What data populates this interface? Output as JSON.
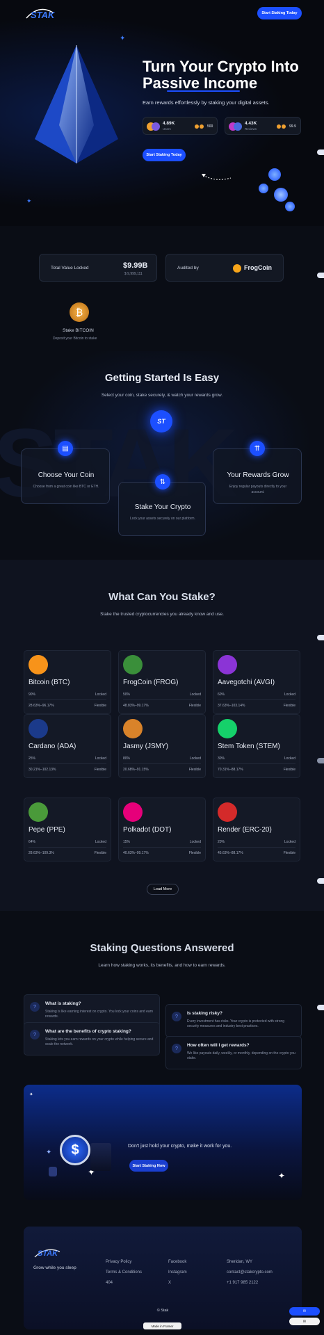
{
  "nav": {
    "logo": "STAK",
    "cta": "Start Staking Today"
  },
  "hero": {
    "title_line1": "Turn Your Crypto Into",
    "title_line2": "Passive Income",
    "subtitle": "Earn rewards effortlessly by staking your digital assets.",
    "stat1_value": "4.89K",
    "stat1_label": "Users",
    "stat1_count": "500",
    "stat2_value": "4.43K",
    "stat2_label": "Reviews",
    "stat2_count": "99.9",
    "cta": "Start Staking Today"
  },
  "tvl": {
    "label": "Total Value Locked",
    "value": "$9.99B",
    "sub": "$ 9,999,111",
    "audited_label": "Audited by",
    "audited_brand": "FrogCoin"
  },
  "stake_coin": {
    "title": "Stake BITCOIN",
    "sub": "Deposit your Bitcoin to stake"
  },
  "getting_started": {
    "title": "Getting Started Is Easy",
    "subtitle": "Select your coin, stake securely, & watch your rewards grow.",
    "step1_title": "Choose Your Coin",
    "step1_desc": "Choose from a great coin like BTC or ETH.",
    "step2_title": "Stake Your Crypto",
    "step2_desc": "Lock your assets securely on our platform.",
    "step3_title": "Your Rewards Grow",
    "step3_desc": "Enjoy regular payouts directly to your account."
  },
  "what_stake": {
    "title": "What Can You Stake?",
    "subtitle": "Stake the trusted cryptocurrencies you already know and use.",
    "coins": [
      {
        "name": "Bitcoin (BTC)",
        "pct": "90%",
        "lock": "Locked",
        "apy": "28.63%–96.17%",
        "flex": "Flexible",
        "color": "#f7931a"
      },
      {
        "name": "FrogCoin (FROG)",
        "pct": "50%",
        "lock": "Locked",
        "apy": "48.83%–99.17%",
        "flex": "Flexible",
        "color": "#3a8f3a"
      },
      {
        "name": "Aavegotchi (AVGI)",
        "pct": "60%",
        "lock": "Locked",
        "apy": "37.63%–103.14%",
        "flex": "Flexible",
        "color": "#8b34d6"
      },
      {
        "name": "Cardano (ADA)",
        "pct": "25%",
        "lock": "Locked",
        "apy": "30.21%–102.13%",
        "flex": "Flexible",
        "color": "#1b3a8a"
      },
      {
        "name": "Jasmy (JSMY)",
        "pct": "80%",
        "lock": "Locked",
        "apy": "20.68%–91.15%",
        "flex": "Flexible",
        "color": "#d9832a"
      },
      {
        "name": "Stem Token (STEM)",
        "pct": "30%",
        "lock": "Locked",
        "apy": "70.31%–88.17%",
        "flex": "Flexible",
        "color": "#15d16a"
      },
      {
        "name": "Pepe (PPE)",
        "pct": "64%",
        "lock": "Locked",
        "apy": "28.63%–109.3%",
        "flex": "Flexible",
        "color": "#4a9a3a"
      },
      {
        "name": "Polkadot (DOT)",
        "pct": "15%",
        "lock": "Locked",
        "apy": "40.63%–99.17%",
        "flex": "Flexible",
        "color": "#e6007a"
      },
      {
        "name": "Render (ERC-20)",
        "pct": "20%",
        "lock": "Locked",
        "apy": "45.63%–88.17%",
        "flex": "Flexible",
        "color": "#d42a2a"
      }
    ],
    "load_more": "Load More"
  },
  "faq": {
    "title": "Staking Questions Answered",
    "subtitle": "Learn how staking works, its benefits, and how to earn rewards.",
    "items": [
      {
        "q": "What is staking?",
        "a": "Staking is like earning interest on crypto. You lock your coins and earn rewards."
      },
      {
        "q": "Is staking risky?",
        "a": "Every investment has risks. Your crypto is protected with strong security measures and industry best practices."
      },
      {
        "q": "What are the benefits of crypto staking?",
        "a": "Staking lets you earn rewards on your crypto while helping secure and scale the network."
      },
      {
        "q": "How often will I get rewards?",
        "a": "We like payouts daily, weekly, or monthly, depending on the crypto you stake."
      }
    ]
  },
  "cta_banner": {
    "text": "Don't just hold your crypto, make it work for you.",
    "button": "Start Staking Now"
  },
  "footer": {
    "logo": "STAK",
    "tagline": "Grow while you sleep",
    "col1": [
      "Privacy Policy",
      "Terms & Conditions",
      "404"
    ],
    "col2": [
      "Facebook",
      "Instagram",
      "X"
    ],
    "col3": [
      "Sheridan, WY",
      "contact@stakcrypto.com",
      "+1 917 985 2122"
    ],
    "copyright": "© Stak",
    "badge": "Made in Framer"
  },
  "colors": {
    "accent": "#1c4fff",
    "bg": "#07090f",
    "card": "#131823"
  }
}
